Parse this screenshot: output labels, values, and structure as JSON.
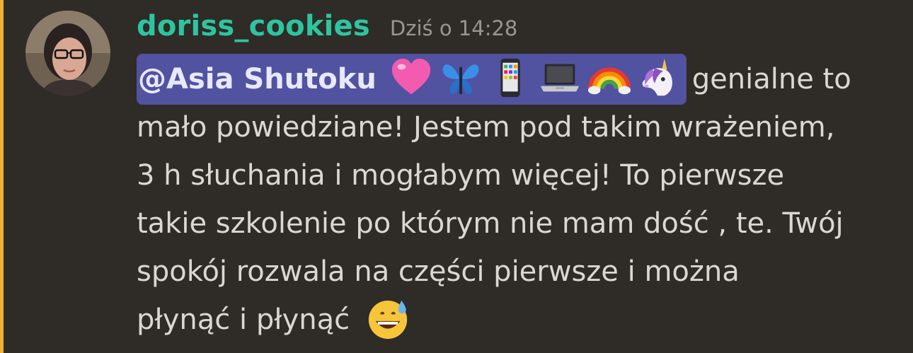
{
  "message": {
    "author": "doriss_cookies",
    "timestamp": "Dziś o 14:28",
    "mention": "@Asia Shutoku",
    "mention_emojis": [
      "heart-icon",
      "butterfly-icon",
      "phone-icon",
      "laptop-icon",
      "rainbow-icon",
      "unicorn-icon"
    ],
    "lines": [
      "genialne to",
      "mało powiedziane! Jestem pod takim wrażeniem,",
      "3 h słuchania i mogłabym więcej! To pierwsze",
      "takie szkolenie po którym nie mam dość , te. Twój",
      "spokój rozwala na części pierwsze i można",
      "płynąć i płynąć"
    ],
    "trailing_emoji": "grinning-sweat-icon"
  },
  "colors": {
    "background": "#2f2b27",
    "accent_bar": "#f0b232",
    "username": "#2dc5a0",
    "mention_bg": "#5152a0"
  }
}
